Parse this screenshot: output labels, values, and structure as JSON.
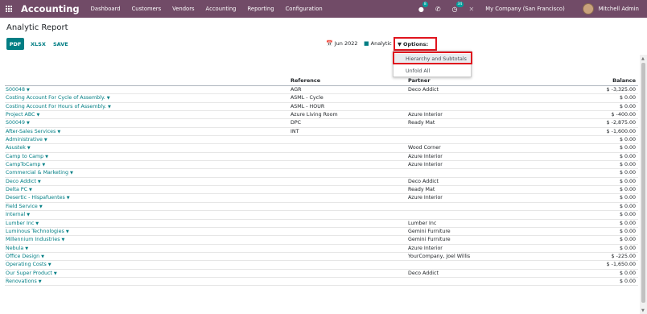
{
  "navbar": {
    "brand": "Accounting",
    "menu": [
      "Dashboard",
      "Customers",
      "Vendors",
      "Accounting",
      "Reporting",
      "Configuration"
    ],
    "chat_badge": "8",
    "activity_badge": "34",
    "company": "My Company (San Francisco)",
    "user": "Mitchell Admin",
    "color": "#714b67"
  },
  "page": {
    "title": "Analytic Report",
    "pdf_label": "PDF",
    "xlsx_label": "XLSX",
    "save_label": "SAVE",
    "date_filter": "Jun 2022",
    "analytic_filter": "Analytic",
    "options_label": "Options:"
  },
  "dropdown": {
    "items": [
      "Hierarchy and Subtotals",
      "Unfold All"
    ]
  },
  "table": {
    "headers": {
      "reference": "Reference",
      "partner": "Partner",
      "balance": "Balance"
    },
    "rows": [
      {
        "name": "S00048",
        "reference": "AGR",
        "partner": "Deco Addict",
        "balance": "$ -3,325.00"
      },
      {
        "name": "Costing Account For Cycle of Assembly.",
        "reference": "ASML - Cycle",
        "partner": "",
        "balance": "$ 0.00"
      },
      {
        "name": "Costing Account For Hours of Assembly.",
        "reference": "ASML - HOUR",
        "partner": "",
        "balance": "$ 0.00"
      },
      {
        "name": "Project ABC",
        "reference": "Azure Living Room",
        "partner": "Azure Interior",
        "balance": "$ -400.00"
      },
      {
        "name": "S00049",
        "reference": "DPC",
        "partner": "Ready Mat",
        "balance": "$ -2,875.00"
      },
      {
        "name": "After-Sales Services",
        "reference": "INT",
        "partner": "",
        "balance": "$ -1,600.00"
      },
      {
        "name": "Administrative",
        "reference": "",
        "partner": "",
        "balance": "$ 0.00"
      },
      {
        "name": "Asustek",
        "reference": "",
        "partner": "Wood Corner",
        "balance": "$ 0.00"
      },
      {
        "name": "Camp to Camp",
        "reference": "",
        "partner": "Azure Interior",
        "balance": "$ 0.00"
      },
      {
        "name": "CampToCamp",
        "reference": "",
        "partner": "Azure Interior",
        "balance": "$ 0.00"
      },
      {
        "name": "Commercial & Marketing",
        "reference": "",
        "partner": "",
        "balance": "$ 0.00"
      },
      {
        "name": "Deco Addict",
        "reference": "",
        "partner": "Deco Addict",
        "balance": "$ 0.00"
      },
      {
        "name": "Delta PC",
        "reference": "",
        "partner": "Ready Mat",
        "balance": "$ 0.00"
      },
      {
        "name": "Desertic - Hispafuentes",
        "reference": "",
        "partner": "Azure Interior",
        "balance": "$ 0.00"
      },
      {
        "name": "Field Service",
        "reference": "",
        "partner": "",
        "balance": "$ 0.00"
      },
      {
        "name": "Internal",
        "reference": "",
        "partner": "",
        "balance": "$ 0.00"
      },
      {
        "name": "Lumber Inc",
        "reference": "",
        "partner": "Lumber Inc",
        "balance": "$ 0.00"
      },
      {
        "name": "Luminous Technologies",
        "reference": "",
        "partner": "Gemini Furniture",
        "balance": "$ 0.00"
      },
      {
        "name": "Millennium Industries",
        "reference": "",
        "partner": "Gemini Furniture",
        "balance": "$ 0.00"
      },
      {
        "name": "Nebula",
        "reference": "",
        "partner": "Azure Interior",
        "balance": "$ 0.00"
      },
      {
        "name": "Office Design",
        "reference": "",
        "partner": "YourCompany, Joel Willis",
        "balance": "$ -225.00"
      },
      {
        "name": "Operating Costs",
        "reference": "",
        "partner": "",
        "balance": "$ -1,650.00"
      },
      {
        "name": "Our Super Product",
        "reference": "",
        "partner": "Deco Addict",
        "balance": "$ 0.00"
      },
      {
        "name": "Renovations",
        "reference": "",
        "partner": "",
        "balance": "$ 0.00"
      }
    ]
  }
}
